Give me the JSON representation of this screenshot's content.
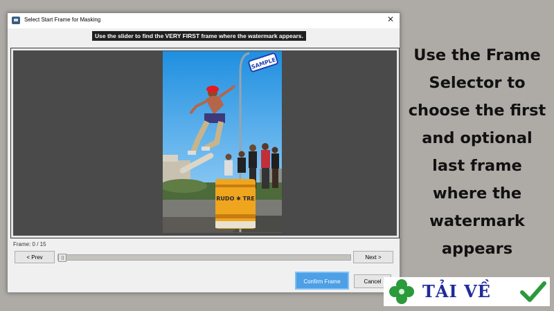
{
  "dialog": {
    "title": "Select Start Frame for Masking",
    "close_glyph": "✕",
    "instruction": "Use the slider to find the VERY FIRST frame where the watermark appears.",
    "preview": {
      "image_description_icons": [
        "skateboarder",
        "crowd",
        "barrel",
        "street-lamp"
      ],
      "watermark_text": "SAMPLE",
      "barrel_text": "RUDO ✱ TRE"
    },
    "frame_label": "Frame: 0 / 15",
    "frame_current": 0,
    "frame_total": 15,
    "prev_label": "< Prev",
    "next_label": "Next >",
    "confirm_label": "Confirm Frame",
    "cancel_label": "Cancel",
    "accent_color": "#4d9fe6"
  },
  "side_caption": {
    "lines": [
      "Use the Frame",
      "Selector to",
      "choose the first",
      "and optional",
      "last frame",
      "where the",
      "watermark",
      "appears"
    ]
  },
  "brand": {
    "text": "TẢI VỀ",
    "icons": [
      "clover-icon",
      "checkmark-icon"
    ],
    "text_color": "#1f2b9c",
    "clover_color": "#2a9a3a",
    "check_color": "#2a9a3a"
  }
}
